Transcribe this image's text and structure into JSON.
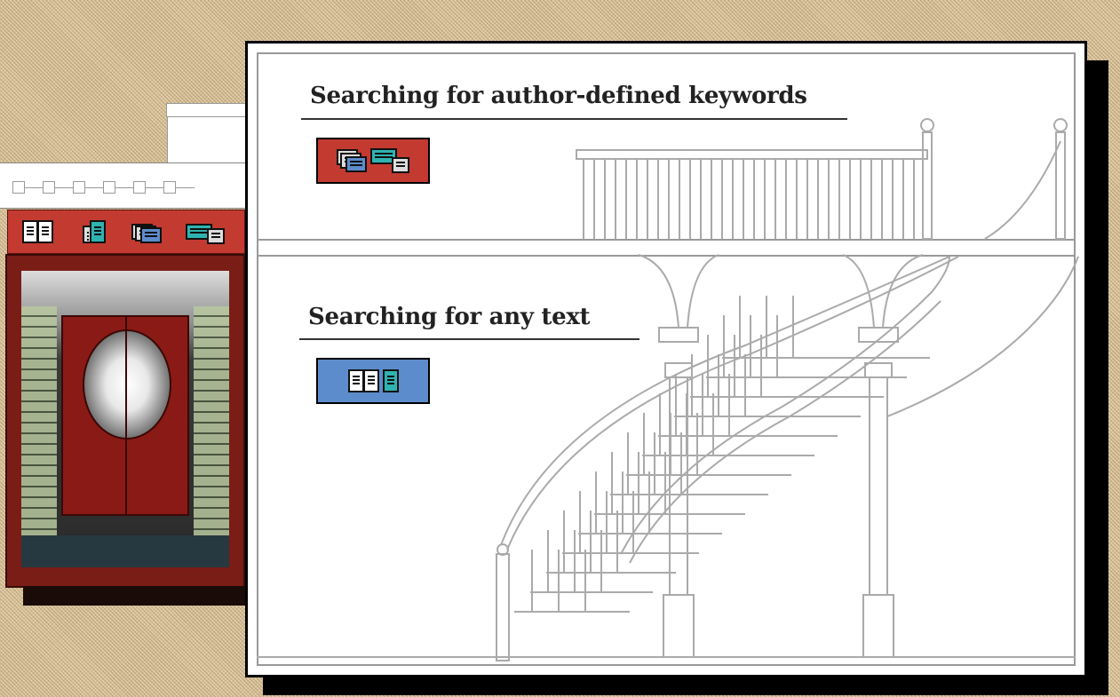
{
  "sections": {
    "keywords": {
      "heading": "Searching for author-defined keywords",
      "button_color": "#c23a30",
      "button_icons": [
        "card-stack-icon",
        "card-icon"
      ]
    },
    "text": {
      "heading": "Searching for any text",
      "button_color": "#5d8ccc",
      "button_icons": [
        "book-icon",
        "page-icon"
      ]
    }
  },
  "toolbar": {
    "background": "#c23a30",
    "icons": [
      "book-icon",
      "page-icon",
      "card-stack-icon",
      "card-icon"
    ]
  },
  "colors": {
    "panel": "#ffffff",
    "frame": "#7a1d16",
    "backdrop": "#d9c29a"
  }
}
